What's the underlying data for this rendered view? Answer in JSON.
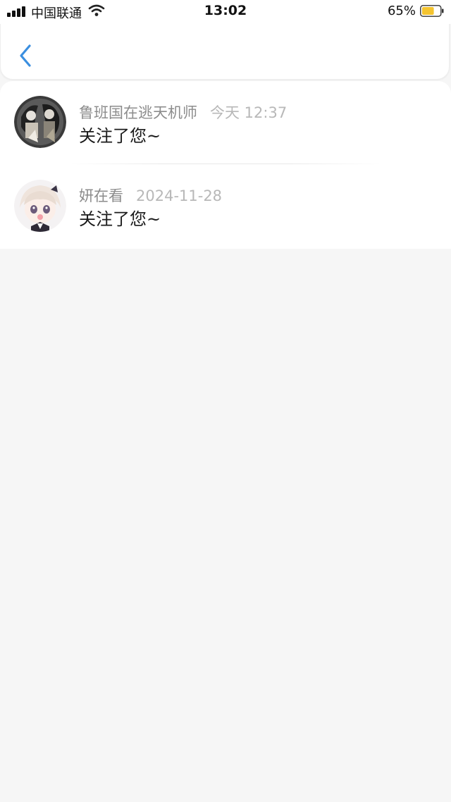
{
  "status_bar": {
    "carrier": "中国联通",
    "time": "13:02",
    "battery": "65%",
    "battery_level": 0.65,
    "battery_color": "#f4c430"
  },
  "header": {
    "back_icon": "chevron-left-icon",
    "accent_color": "#3b8fe0"
  },
  "notifications": [
    {
      "name": "鲁班国在逃天机师",
      "time": "今天 12:37",
      "message": "关注了您~"
    },
    {
      "name": "妍在看",
      "time": "2024-11-28",
      "message": "关注了您~"
    }
  ]
}
